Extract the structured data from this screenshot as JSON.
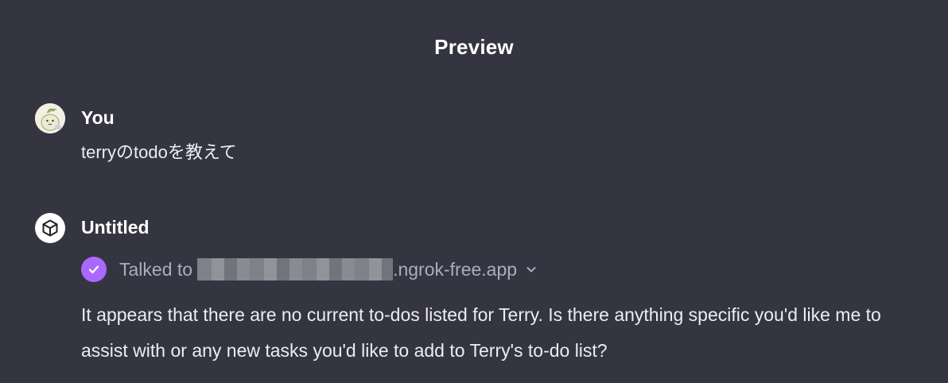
{
  "header": {
    "title": "Preview"
  },
  "messages": {
    "user": {
      "author": "You",
      "text": "terryのtodoを教えて"
    },
    "assistant": {
      "author": "Untitled",
      "tool_call": {
        "prefix": "Talked to",
        "suffix": ".ngrok-free.app"
      },
      "text": "It appears that there are no current to-dos listed for Terry. Is there anything specific you'd like me to assist with or any new tasks you'd like to add to Terry's to-do list?"
    }
  },
  "colors": {
    "background": "#343541",
    "accent_check": "#ab68ff",
    "text_primary": "#ececf1",
    "text_muted": "#acacbe"
  },
  "icons": {
    "user_avatar": "user-avatar-illustration",
    "assistant_avatar": "cube-icon",
    "tool_status": "check-icon",
    "expand": "chevron-down-icon"
  }
}
